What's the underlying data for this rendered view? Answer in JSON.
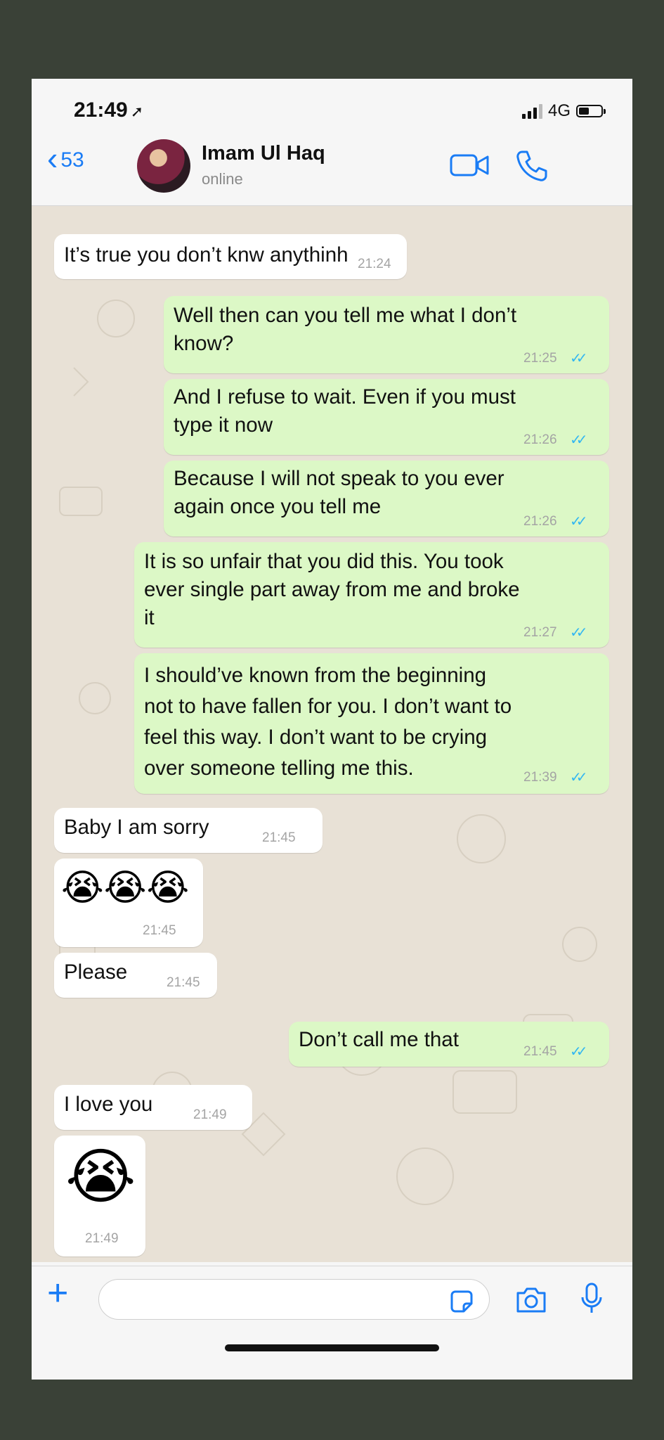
{
  "status": {
    "time": "21:49",
    "network": "4G"
  },
  "header": {
    "back_count": "53",
    "name": "Imam Ul Haq",
    "status": "online"
  },
  "messages": [
    {
      "dir": "in",
      "text": "It’s true you don’t knw anythinh",
      "time": "21:24"
    },
    {
      "dir": "out",
      "text": "Well then can you tell me what I don’t\nknow?",
      "time": "21:25",
      "read": true
    },
    {
      "dir": "out",
      "text": "And I refuse to wait. Even if you must\ntype it now",
      "time": "21:26",
      "read": true
    },
    {
      "dir": "out",
      "text": "Because I will not speak to you ever\nagain once you tell me",
      "time": "21:26",
      "read": true
    },
    {
      "dir": "out",
      "text": "It is so unfair that you did this. You took\never single part away from me and broke\nit",
      "time": "21:27",
      "read": true
    },
    {
      "dir": "out",
      "text": "I should’ve known from the beginning\nnot to have fallen for you. I don’t want to\nfeel this way. I don’t want to be crying\nover someone telling me this.",
      "time": "21:39",
      "read": true
    },
    {
      "dir": "in",
      "text": "Baby I am sorry",
      "time": "21:45"
    },
    {
      "dir": "in",
      "text": "😭😭😭",
      "time": "21:45"
    },
    {
      "dir": "in",
      "text": "Please",
      "time": "21:45"
    },
    {
      "dir": "out",
      "text": "Don’t call me that",
      "time": "21:45",
      "read": true
    },
    {
      "dir": "in",
      "text": "I love you",
      "time": "21:49"
    },
    {
      "dir": "in",
      "text": "😭",
      "time": "21:49"
    }
  ],
  "colors": {
    "incoming": "#ffffff",
    "outgoing": "#dcf8c6",
    "accent": "#1a7cf5",
    "read_ticks": "#34b7f1",
    "chat_bg": "#e8e1d6"
  },
  "icons": [
    "location-arrow-icon",
    "signal-icon",
    "battery-icon",
    "back-chevron-icon",
    "video-call-icon",
    "phone-icon",
    "plus-icon",
    "sticker-icon",
    "camera-icon",
    "microphone-icon"
  ]
}
